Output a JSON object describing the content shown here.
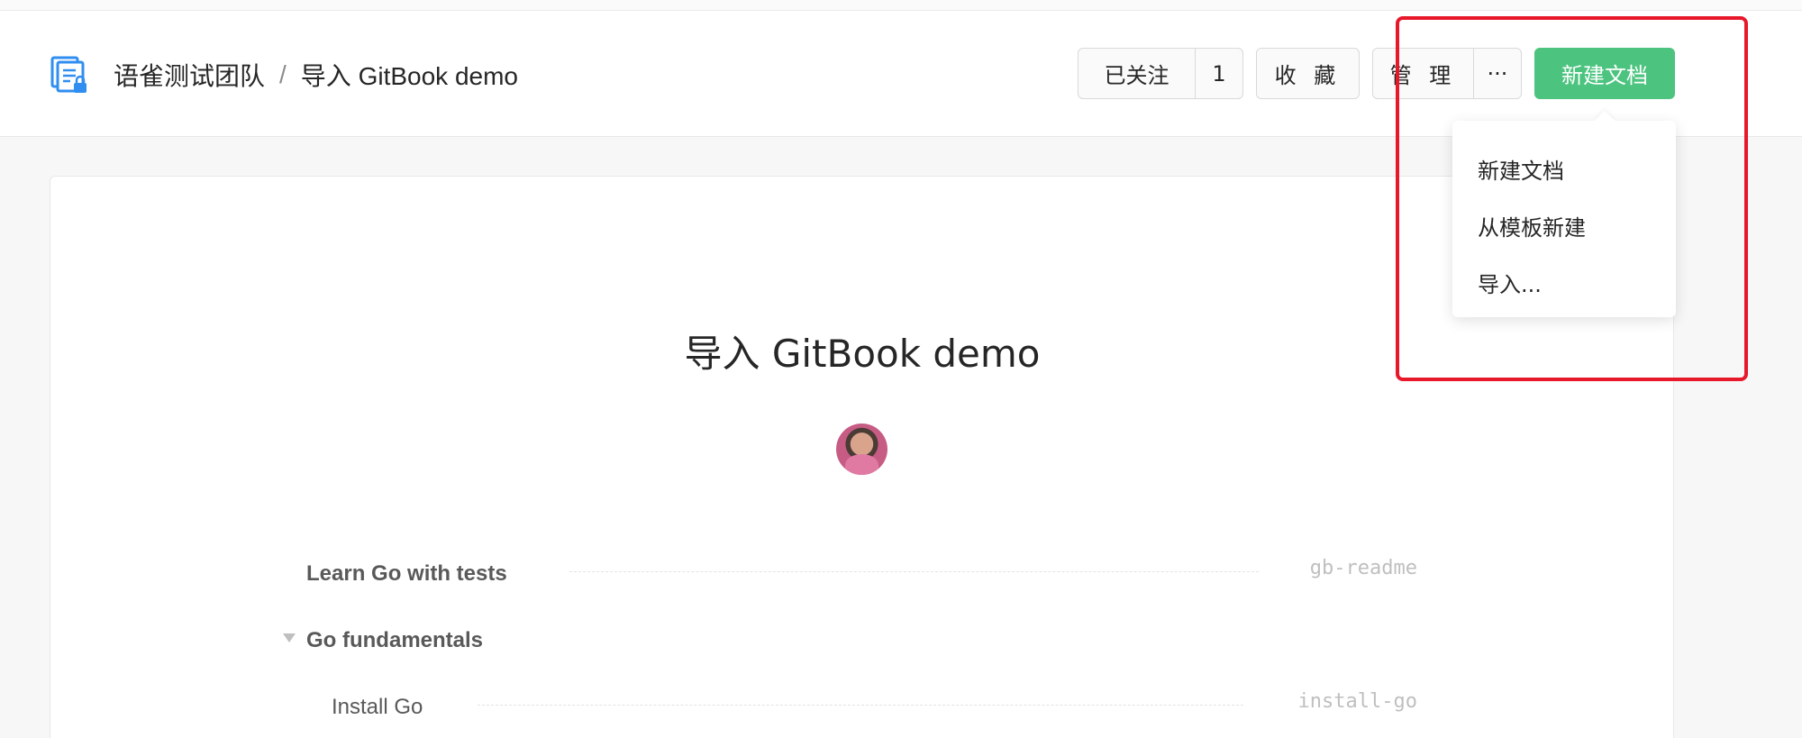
{
  "header": {
    "team": "语雀测试团队",
    "separator": "/",
    "book": "导入 GitBook demo"
  },
  "actions": {
    "follow_label": "已关注",
    "follow_count": "1",
    "star_label": "收 藏",
    "manage_label": "管 理",
    "more_label": "···",
    "new_doc_label": "新建文档"
  },
  "dropdown": {
    "items": [
      {
        "label": "新建文档"
      },
      {
        "label": "从模板新建"
      },
      {
        "label": "导入..."
      }
    ]
  },
  "doc": {
    "title": "导入 GitBook demo"
  },
  "toc": [
    {
      "title": "Learn Go with tests",
      "slug": "gb-readme"
    },
    {
      "title": "Go fundamentals",
      "slug": ""
    },
    {
      "title": "Install Go",
      "slug": "install-go"
    }
  ],
  "colors": {
    "primary_green": "#4cc47f",
    "highlight_red": "#e8182b",
    "icon_blue": "#2f8ef0"
  },
  "icons": {
    "book": "book-lock-icon",
    "collapse": "triangle-down-icon"
  }
}
